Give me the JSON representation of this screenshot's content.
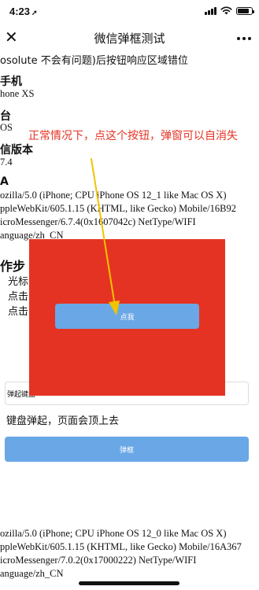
{
  "status_bar": {
    "time": "4:23",
    "location_arrow": "location-arrow-icon",
    "battery_level": 0.8
  },
  "nav": {
    "close": "✕",
    "title": "微信弹框测试"
  },
  "content": {
    "issue_note": "osolute 不会有问题)后按钮响应区域错位",
    "phone_model_heading": "手机",
    "phone_model": "hone XS",
    "platform_heading": "台",
    "platform": "OS",
    "wechat_version_heading": "信版本",
    "wechat_version": "7.4",
    "ua_heading": "A",
    "ua_1": [
      "ozilla/5.0 (iPhone; CPU iPhone OS 12_1 like Mac OS X)",
      "ppleWebKit/605.1.15 (KHTML, like Gecko) Mobile/16B92",
      "icroMessenger/6.7.4(0x1607042c) NetType/WIFI",
      "anguage/zh_CN"
    ],
    "steps_heading": "作步",
    "steps": [
      "光标",
      "点击",
      "点击"
    ],
    "keyboard_input_value": "弹起键盘",
    "keyboard_note": "键盘弹起，页面会顶上去",
    "popup_button": "弹框",
    "ua_2": [
      "ozilla/5.0 (iPhone; CPU iPhone OS 12_0 like Mac OS X)",
      "ppleWebKit/605.1.15 (KHTML, like Gecko) Mobile/16A367",
      "icroMessenger/7.0.2(0x17000222) NetType/WIFI",
      "anguage/zh_CN"
    ]
  },
  "overlay": {
    "button": "点我"
  },
  "annotation": {
    "text": "正常情况下，点这个按钮，弹窗可以自消失"
  },
  "colors": {
    "overlay_red": "#e53323",
    "button_blue": "#6aa7e6",
    "annotation_red": "#e53323",
    "arrow_yellow": "#f2c300"
  }
}
